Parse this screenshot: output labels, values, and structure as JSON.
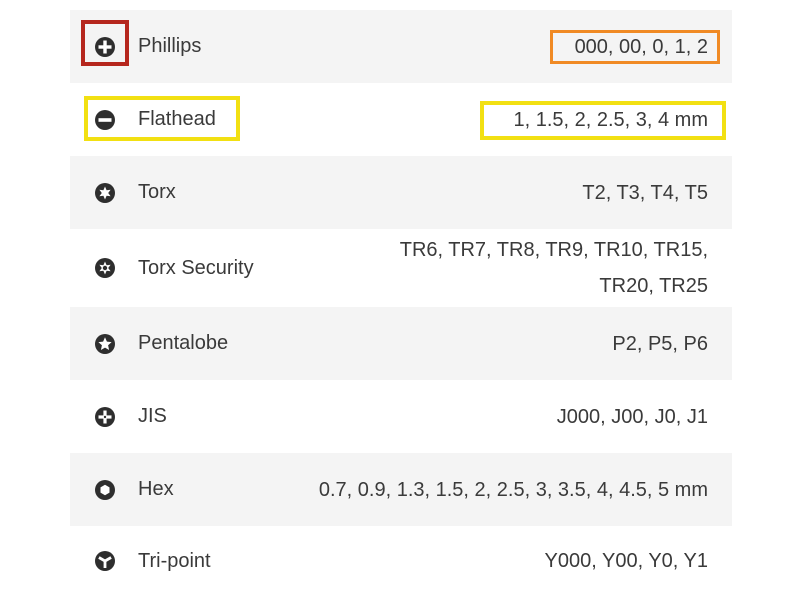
{
  "bit_types": [
    {
      "name": "Phillips",
      "icon": "phillips-icon",
      "sizes": "000, 00, 0, 1, 2"
    },
    {
      "name": "Flathead",
      "icon": "flathead-icon",
      "sizes": "1, 1.5, 2, 2.5, 3, 4 mm"
    },
    {
      "name": "Torx",
      "icon": "torx-icon",
      "sizes": "T2, T3, T4, T5"
    },
    {
      "name": "Torx Security",
      "icon": "torx-security-icon",
      "sizes": "TR6, TR7, TR8, TR9, TR10, TR15, TR20, TR25"
    },
    {
      "name": "Pentalobe",
      "icon": "pentalobe-icon",
      "sizes": "P2, P5, P6"
    },
    {
      "name": "JIS",
      "icon": "jis-icon",
      "sizes": "J000, J00, J0, J1"
    },
    {
      "name": "Hex",
      "icon": "hex-icon",
      "sizes": "0.7, 0.9, 1.3, 1.5, 2, 2.5, 3, 3.5, 4, 4.5, 5 mm"
    },
    {
      "name": "Tri-point",
      "icon": "tri-point-icon",
      "sizes": "Y000, Y00, Y0, Y1"
    }
  ],
  "highlight_colors": {
    "red": "#b5261d",
    "orange": "#f08a24",
    "yellow": "#f2e012"
  },
  "colors": {
    "row_shade": "#f4f4f4",
    "text": "#3a3a3a",
    "icon": "#2e2e2e"
  }
}
